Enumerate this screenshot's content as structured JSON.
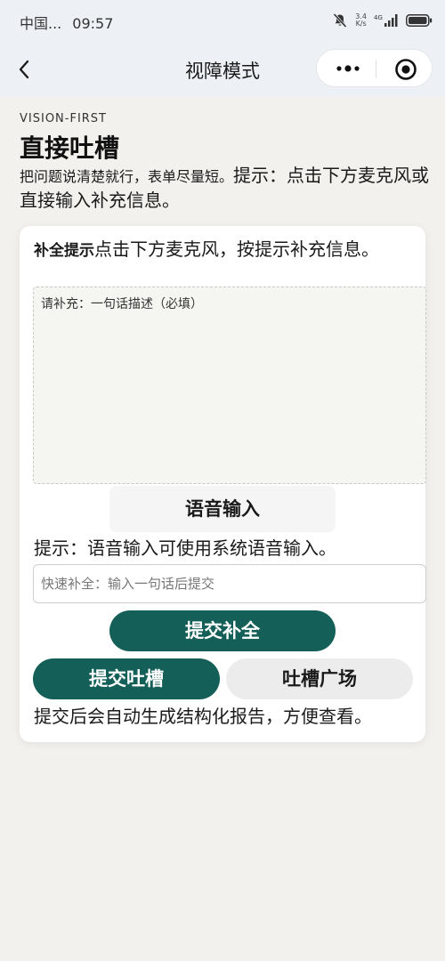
{
  "status_bar": {
    "carrier": "中国...",
    "time": "09:57",
    "net_speed_top": "3.4",
    "net_speed_bottom": "K/s",
    "network_type": "4G",
    "icons": [
      "mute-icon",
      "signal-icon",
      "battery-icon"
    ]
  },
  "nav": {
    "back_icon": "chevron-left-icon",
    "title": "视障模式",
    "capsule_icons": [
      "more-icon",
      "target-icon"
    ]
  },
  "header": {
    "eyebrow": "VISION-FIRST",
    "title": "直接吐槽",
    "intro_small": "把问题说清楚就行，表单尽量短。",
    "intro_big": "提示：点击下方麦克风或直接输入补充信息。"
  },
  "card": {
    "hint_label": "补全提示",
    "hint_text": "点击下方麦克风，按提示补充信息。",
    "textarea_placeholder": "请补充：一句话描述（必填）",
    "voice_button": "语音输入",
    "voice_tip": "提示：语音输入可使用系统语音输入。",
    "quick_input_placeholder": "快速补全：输入一句话后提交",
    "submit_fill_button": "提交补全",
    "submit_rant_button": "提交吐槽",
    "rant_square_button": "吐槽广场",
    "footer_note": "提交后会自动生成结构化报告，方便查看。"
  },
  "colors": {
    "primary": "#155f59",
    "page_background": "#f2f1ee",
    "header_background": "#edf0f4"
  }
}
